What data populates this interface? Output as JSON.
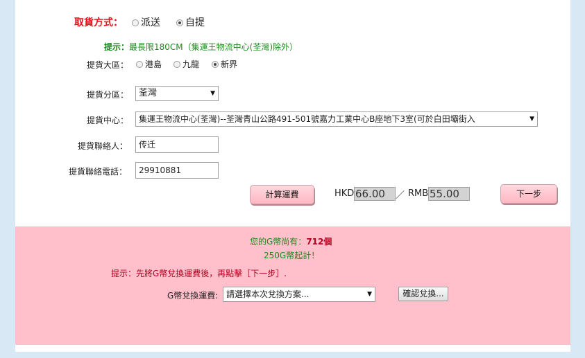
{
  "pickup_method": {
    "label": "取貨方式：",
    "options": [
      "派送",
      "自提"
    ],
    "selected": "自提"
  },
  "hint": {
    "prefix": "提示：",
    "text": "最長限180CM（集運王物流中心(荃灣)除外）"
  },
  "region": {
    "label": "提貨大區：",
    "options": [
      "港島",
      "九龍",
      "新界"
    ],
    "selected": "新界"
  },
  "district": {
    "label": "提貨分區：",
    "value": "荃灣"
  },
  "center": {
    "label": "提貨中心：",
    "value": "集運王物流中心(荃灣)--荃灣青山公路491-501號嘉力工業中心B座地下3室(可於白田壩街入"
  },
  "contact": {
    "label": "提貨聯絡人：",
    "value": "传迁"
  },
  "phone": {
    "label": "提貨聯絡電話：",
    "value": "29910881"
  },
  "calc_button": "計算運費",
  "hkd": {
    "label": "HKD",
    "value": "66.00"
  },
  "slash": "／",
  "rmb": {
    "label": "RMB",
    "value": "55.00"
  },
  "next_button": "下一步",
  "coins": {
    "balance_prefix": "您的G幣尚有：",
    "balance_value": "712個",
    "minimum": "250G幣起計！",
    "tip": "提示：先將G幣兌換運費後，再點擊［下一步］.",
    "exchange_label": "G幣兌換運費:",
    "exchange_select": "請選擇本次兌換方案...",
    "confirm_button": "確認兌換..."
  },
  "colors": {
    "accent_red": "#e8101c",
    "hint_green": "#1d8a1d",
    "pink_bg": "#ffc0cb",
    "page_bg": "#d8e8f4"
  }
}
